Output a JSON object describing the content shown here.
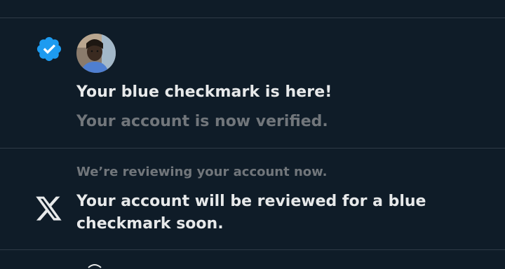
{
  "notifications": [
    {
      "icon": "verified-badge-icon",
      "avatar": "user-avatar",
      "title": "Your blue checkmark is here!",
      "subtitle": "Your account is now verified."
    },
    {
      "icon": "x-logo-icon",
      "header": "We’re reviewing your account now.",
      "body": "Your account will be reviewed for a blue checkmark soon."
    }
  ],
  "colors": {
    "background": "#0f1c28",
    "divider": "#2f3b47",
    "primary_text": "#e7e9ea",
    "secondary_text": "#71767b",
    "verified_blue": "#1d9bf0"
  }
}
